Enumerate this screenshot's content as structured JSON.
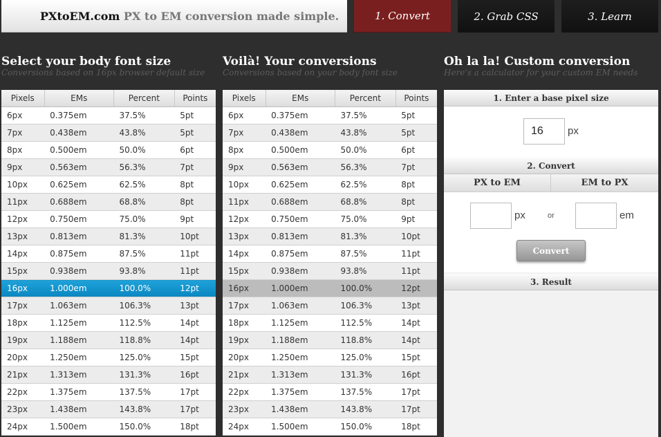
{
  "header": {
    "logo_name": "PXtoEM.com",
    "logo_tagline": "PX to EM conversion made simple.",
    "tabs": [
      {
        "label": "1. Convert"
      },
      {
        "label": "2. Grab CSS"
      },
      {
        "label": "3. Learn"
      }
    ]
  },
  "left": {
    "title": "Select your body font size",
    "subtitle": "Conversions based on 16px browser default size"
  },
  "middle": {
    "title": "Voilà! Your conversions",
    "subtitle": "Conversions based on your body font size"
  },
  "custom": {
    "title": "Oh la la! Custom conversion",
    "subtitle": "Here's a calculator for your custom EM needs",
    "step1": "1. Enter a base pixel size",
    "base_value": "16",
    "base_unit": "px",
    "step2": "2. Convert",
    "px_to_em": "PX to EM",
    "em_to_px": "EM to PX",
    "px_unit": "px",
    "or": "or",
    "em_unit": "em",
    "convert_button": "Convert",
    "step3": "3. Result"
  },
  "table_headers": [
    "Pixels",
    "EMs",
    "Percent",
    "Points"
  ],
  "highlight_index": 10,
  "rows": [
    [
      "6px",
      "0.375em",
      "37.5%",
      "5pt"
    ],
    [
      "7px",
      "0.438em",
      "43.8%",
      "5pt"
    ],
    [
      "8px",
      "0.500em",
      "50.0%",
      "6pt"
    ],
    [
      "9px",
      "0.563em",
      "56.3%",
      "7pt"
    ],
    [
      "10px",
      "0.625em",
      "62.5%",
      "8pt"
    ],
    [
      "11px",
      "0.688em",
      "68.8%",
      "8pt"
    ],
    [
      "12px",
      "0.750em",
      "75.0%",
      "9pt"
    ],
    [
      "13px",
      "0.813em",
      "81.3%",
      "10pt"
    ],
    [
      "14px",
      "0.875em",
      "87.5%",
      "11pt"
    ],
    [
      "15px",
      "0.938em",
      "93.8%",
      "11pt"
    ],
    [
      "16px",
      "1.000em",
      "100.0%",
      "12pt"
    ],
    [
      "17px",
      "1.063em",
      "106.3%",
      "13pt"
    ],
    [
      "18px",
      "1.125em",
      "112.5%",
      "14pt"
    ],
    [
      "19px",
      "1.188em",
      "118.8%",
      "14pt"
    ],
    [
      "20px",
      "1.250em",
      "125.0%",
      "15pt"
    ],
    [
      "21px",
      "1.313em",
      "131.3%",
      "16pt"
    ],
    [
      "22px",
      "1.375em",
      "137.5%",
      "17pt"
    ],
    [
      "23px",
      "1.438em",
      "143.8%",
      "17pt"
    ],
    [
      "24px",
      "1.500em",
      "150.0%",
      "18pt"
    ]
  ]
}
